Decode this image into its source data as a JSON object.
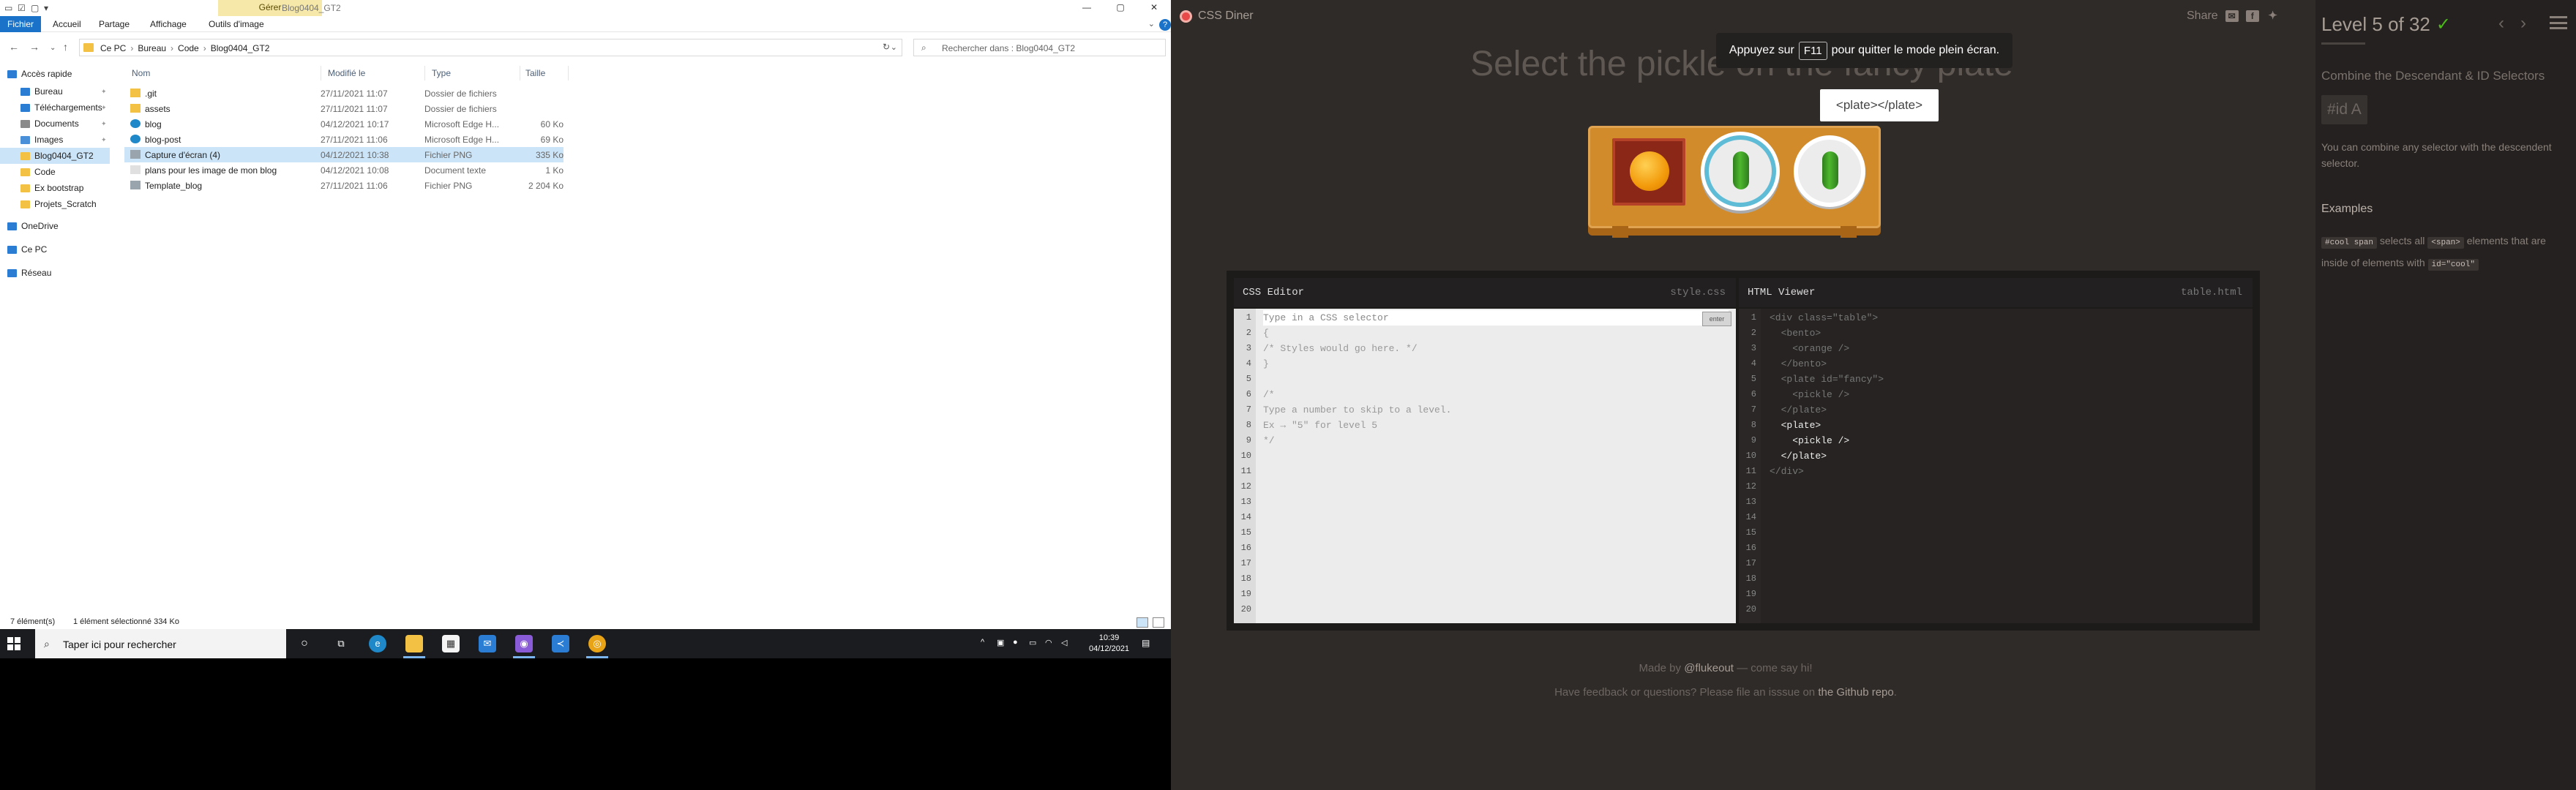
{
  "explorer": {
    "title": "Blog0404_GT2",
    "gerer_label": "Gérer",
    "ribbon_tabs": [
      "Fichier",
      "Accueil",
      "Partage",
      "Affichage"
    ],
    "outils_label": "Outils d'image",
    "breadcrumb": [
      "Ce PC",
      "Bureau",
      "Code",
      "Blog0404_GT2"
    ],
    "search_placeholder": "Rechercher dans : Blog0404_GT2",
    "nav_items": [
      {
        "label": "Accès rapide",
        "icon": "star-icon",
        "color": "#2b7cd3"
      },
      {
        "label": "Bureau",
        "icon": "desktop-icon",
        "color": "#2b7cd3"
      },
      {
        "label": "Téléchargements",
        "icon": "download-icon",
        "color": "#2b7cd3"
      },
      {
        "label": "Documents",
        "icon": "documents-icon",
        "color": "#8a8a8a"
      },
      {
        "label": "Images",
        "icon": "images-icon",
        "color": "#4a90d9"
      },
      {
        "label": "Blog0404_GT2",
        "icon": "folder-icon",
        "color": "#f3c244"
      },
      {
        "label": "Code",
        "icon": "folder-icon",
        "color": "#f3c244"
      },
      {
        "label": "Ex bootstrap",
        "icon": "folder-icon",
        "color": "#f3c244"
      },
      {
        "label": "Projets_Scratch",
        "icon": "folder-icon",
        "color": "#f3c244"
      },
      {
        "label": "OneDrive",
        "icon": "cloud-icon",
        "color": "#2b7cd3"
      },
      {
        "label": "Ce PC",
        "icon": "computer-icon",
        "color": "#2b7cd3"
      },
      {
        "label": "Réseau",
        "icon": "network-icon",
        "color": "#2b7cd3"
      }
    ],
    "columns": {
      "name": "Nom",
      "modified": "Modifié le",
      "type": "Type",
      "size": "Taille"
    },
    "files": [
      {
        "name": ".git",
        "modified": "27/11/2021 11:07",
        "type": "Dossier de fichiers",
        "size": "",
        "icon": "folder-icon",
        "color": "#f3c244"
      },
      {
        "name": "assets",
        "modified": "27/11/2021 11:07",
        "type": "Dossier de fichiers",
        "size": "",
        "icon": "folder-icon",
        "color": "#f3c244"
      },
      {
        "name": "blog",
        "modified": "04/12/2021 10:17",
        "type": "Microsoft Edge H...",
        "size": "60 Ko",
        "icon": "edge-icon",
        "color": "#1e88c8"
      },
      {
        "name": "blog-post",
        "modified": "27/11/2021 11:06",
        "type": "Microsoft Edge H...",
        "size": "69 Ko",
        "icon": "edge-icon",
        "color": "#1e88c8"
      },
      {
        "name": "Capture d'écran (4)",
        "modified": "04/12/2021 10:38",
        "type": "Fichier PNG",
        "size": "335 Ko",
        "icon": "image-file-icon",
        "color": "#9aa4ad"
      },
      {
        "name": "plans pour les image de mon blog",
        "modified": "04/12/2021 10:08",
        "type": "Document texte",
        "size": "1 Ko",
        "icon": "text-file-icon",
        "color": "#e0e0e0"
      },
      {
        "name": "Template_blog",
        "modified": "27/11/2021 11:06",
        "type": "Fichier PNG",
        "size": "2 204 Ko",
        "icon": "image-file-icon",
        "color": "#9aa4ad"
      }
    ],
    "status": {
      "count": "7 élément(s)",
      "selection": "1 élément sélectionné  334 Ko"
    }
  },
  "taskbar": {
    "search_placeholder": "Taper ici pour rechercher",
    "time": "10:39",
    "date": "04/12/2021"
  },
  "diner": {
    "brand": "CSS Diner",
    "share": "Share",
    "instruction": "Select the pickle on the fancy plate",
    "fullscreen_notice": {
      "before": "Appuyez sur",
      "key": "F11",
      "after": "pour quitter le mode plein écran."
    },
    "tooltip": "<plate></plate>",
    "css_editor": {
      "title": "CSS Editor",
      "file": "style.css",
      "enter_label": "enter",
      "lines": [
        "Type in a CSS selector",
        "{",
        "/* Styles would go here. */",
        "}",
        "",
        "/*",
        "Type a number to skip to a level.",
        "Ex → \"5\" for level 5",
        "*/",
        "",
        "",
        "",
        "",
        "",
        "",
        "",
        "",
        "",
        "",
        ""
      ]
    },
    "html_viewer": {
      "title": "HTML Viewer",
      "file": "table.html",
      "lines": [
        "<div class=\"table\">",
        "  <bento>",
        "    <orange />",
        "  </bento>",
        "  <plate id=\"fancy\">",
        "    <pickle />",
        "  </plate>",
        "  <plate>",
        "    <pickle />",
        "  </plate>",
        "</div>",
        "",
        "",
        "",
        "",
        "",
        "",
        "",
        "",
        ""
      ],
      "highlight_lines": [
        7,
        8,
        9
      ]
    },
    "footer_line1": {
      "before": "Made by ",
      "link": "@flukeout",
      "after": " — come say hi!"
    },
    "footer_line2": {
      "before": "Have feedback or questions? Please file an isssue on ",
      "link": "the Github repo",
      "after": "."
    },
    "sidebar": {
      "level": "Level 5 of 32",
      "check": "✓",
      "prev": "‹",
      "next": "›",
      "level_title": "Combine the Descendant & ID Selectors",
      "selector_name": "#id  A",
      "syntax": "You can combine any selector with the descendent selector.",
      "examples_title": "Examples",
      "example": {
        "code1": "#cool span",
        "text1": " selects all ",
        "code2": "<span>",
        "text2": " elements that are inside of elements with ",
        "code3": "id=\"cool\""
      }
    }
  }
}
